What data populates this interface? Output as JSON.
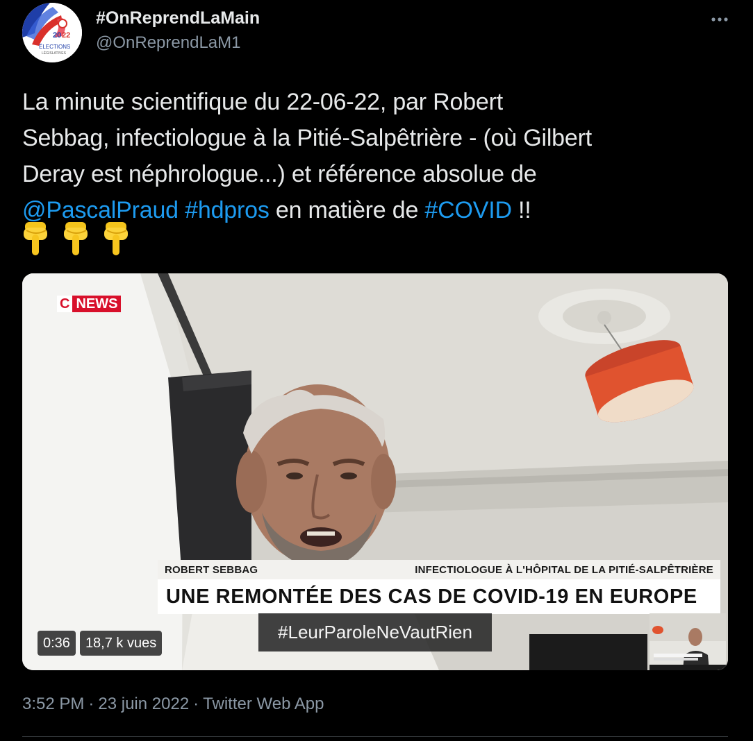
{
  "author": {
    "display_name": "#OnReprendLaMain",
    "handle": "@OnReprendLaM1",
    "avatar_text_top": "20",
    "avatar_text_bottom": "22",
    "avatar_label": "ÉLECTIONS",
    "avatar_sublabel": "LÉGISLATIVES"
  },
  "more_icon": "more-horizontal-icon",
  "tweet": {
    "line1": "La minute scientifique du 22-06-22, par Robert",
    "line2": "Sebbag, infectiologue à la Pitié-Salpêtrière - (où Gilbert",
    "line3": "Deray est néphrologue...) et référence absolue de",
    "mention": "@PascalPraud",
    "hashtag1": "#hdpros",
    "mid_text": " en matière de ",
    "hashtag2": "#COVID",
    "end_text": " !!",
    "emojis": [
      "backhand-index-pointing-down",
      "backhand-index-pointing-down",
      "backhand-index-pointing-down"
    ]
  },
  "video": {
    "channel_c": "C",
    "channel_news": "NEWS",
    "guest_name": "ROBERT SEBBAG",
    "guest_title": "INFECTIOLOGUE À L'HÔPITAL DE LA PITIÉ-SALPÊTRIÈRE",
    "headline": "UNE REMONTÉE DES CAS DE COVID-19 EN EUROPE",
    "hashtag_overlay": "#LeurParoleNeVautRien",
    "duration": "0:36",
    "views": "18,7 k vues"
  },
  "meta": {
    "time": "3:52 PM",
    "separator": "·",
    "date": "23 juin 2022",
    "source": "Twitter Web App"
  },
  "colors": {
    "background": "#000000",
    "text": "#e7e9ea",
    "secondary": "#8b98a5",
    "link": "#1d9bf0",
    "cnews_red": "#d8102b"
  }
}
